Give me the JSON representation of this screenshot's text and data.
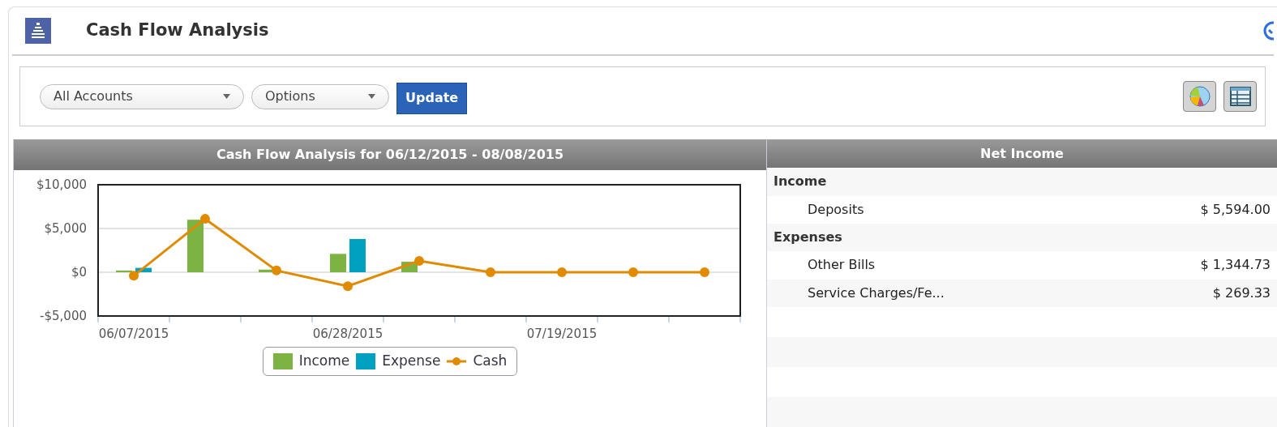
{
  "title": "Cash Flow Analysis",
  "toolbar": {
    "account_select": "All Accounts",
    "options_select": "Options",
    "update_button": "Update"
  },
  "chart_panel": {
    "header": "Cash Flow Analysis for 06/12/2015 - 08/08/2015",
    "chart_data": {
      "type": "bar",
      "categories": [
        "06/07/2015",
        null,
        null,
        "06/28/2015",
        null,
        null,
        "07/19/2015",
        null,
        null
      ],
      "ylim": [
        -5000,
        10000
      ],
      "legend": "bottom",
      "yticks": [
        {
          "value": -5000,
          "label": "-$5,000"
        },
        {
          "value": 0,
          "label": "$0"
        },
        {
          "value": 5000,
          "label": "$5,000"
        },
        {
          "value": 10000,
          "label": "$10,000"
        }
      ],
      "series": [
        {
          "name": "Income",
          "color": "#7cb342",
          "values": [
            200,
            6000,
            300,
            2100,
            1200,
            null,
            null,
            null,
            null
          ]
        },
        {
          "name": "Expense",
          "color": "#00a0c0",
          "values": [
            500,
            null,
            null,
            3800,
            null,
            null,
            null,
            null,
            null
          ]
        },
        {
          "name": "Cash",
          "color": "#e08a00",
          "type": "line",
          "marker": "circle",
          "values": [
            -400,
            6100,
            200,
            -1600,
            1300,
            0,
            0,
            0,
            0
          ]
        }
      ]
    }
  },
  "net_income": {
    "header": "Net Income",
    "rows": [
      {
        "kind": "group",
        "label": "Income"
      },
      {
        "kind": "item",
        "label": "Deposits",
        "amount": "$ 5,594.00"
      },
      {
        "kind": "group",
        "label": "Expenses"
      },
      {
        "kind": "item",
        "label": "Other Bills",
        "amount": "$ 1,344.73"
      },
      {
        "kind": "item",
        "label": "Service Charges/Fe...",
        "amount": "$ 269.33"
      }
    ]
  }
}
